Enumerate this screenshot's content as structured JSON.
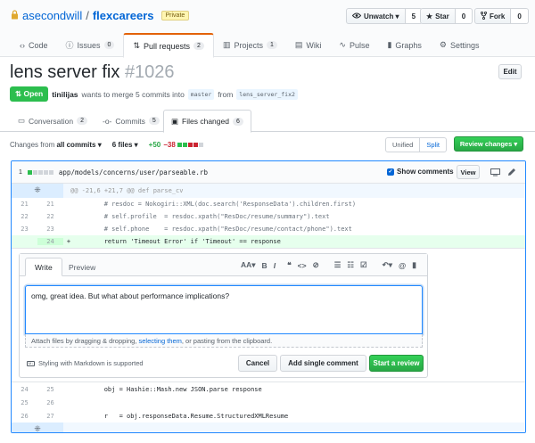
{
  "repo": {
    "owner": "asecondwill",
    "separator": "/",
    "name": "flexcareers",
    "visibility": "Private"
  },
  "actions": {
    "watch": {
      "label": "Unwatch ▾",
      "count": "5"
    },
    "star": {
      "label": "Star",
      "count": "0"
    },
    "fork": {
      "label": "Fork",
      "count": "0"
    }
  },
  "nav": [
    {
      "label": "Code",
      "icon": "code-icon"
    },
    {
      "label": "Issues",
      "count": "0",
      "icon": "issue-icon"
    },
    {
      "label": "Pull requests",
      "count": "2",
      "icon": "pull-request-icon",
      "selected": true
    },
    {
      "label": "Projects",
      "count": "1",
      "icon": "project-icon"
    },
    {
      "label": "Wiki",
      "icon": "book-icon"
    },
    {
      "label": "Pulse",
      "icon": "pulse-icon"
    },
    {
      "label": "Graphs",
      "icon": "graph-icon"
    },
    {
      "label": "Settings",
      "icon": "gear-icon"
    }
  ],
  "pr": {
    "title": "lens server fix",
    "number": "#1026",
    "edit_label": "Edit",
    "state": "Open",
    "author": "tinilijas",
    "summary": "wants to merge 5 commits into",
    "base_branch": "master",
    "from_word": "from",
    "head_branch": "lens_server_fix2"
  },
  "pr_tabs": {
    "conversation": {
      "label": "Conversation",
      "count": "2"
    },
    "commits": {
      "label": "Commits",
      "count": "5"
    },
    "files": {
      "label": "Files changed",
      "count": "6"
    }
  },
  "toolbar": {
    "changes_prefix": "Changes from",
    "changes_value": "all commits ▾",
    "files_label": "6 files ▾",
    "additions": "+50",
    "deletions": "−38",
    "unified": "Unified",
    "split": "Split",
    "review_changes": "Review changes ▾"
  },
  "file": {
    "changes": "1",
    "path": "app/models/concerns/user/parseable.rb",
    "show_comments": "Show comments",
    "view_label": "View"
  },
  "diff_top": {
    "hunk": "@@ -21,6 +21,7 @@ def parse_cv",
    "lines": [
      {
        "old": "21",
        "new": "21",
        "sign": "",
        "code": "        # resdoc = Nokogiri::XML(doc.search('ResponseData').children.first)"
      },
      {
        "old": "22",
        "new": "22",
        "sign": "",
        "code": "        # self.profile  = resdoc.xpath(\"ResDoc/resume/summary\").text"
      },
      {
        "old": "23",
        "new": "23",
        "sign": "",
        "code": "        # self.phone    = resdoc.xpath(\"ResDoc/resume/contact/phone\").text"
      },
      {
        "old": "",
        "new": "24",
        "sign": "+",
        "code": "        return 'Timeout Error' if 'Timeout' == response"
      }
    ]
  },
  "comment_form": {
    "tab_write": "Write",
    "tab_preview": "Preview",
    "toolbar_header": "AA▾",
    "toolbar_bold": "B",
    "toolbar_italic": "I",
    "toolbar_quote": "❝",
    "toolbar_code": "<>",
    "toolbar_link": "⊘",
    "toolbar_ul": "☰",
    "toolbar_ol": "☷",
    "toolbar_task": "☑",
    "toolbar_reply": "↶▾",
    "toolbar_mention": "@",
    "toolbar_bookmark": "▮",
    "text": "omg, great idea.  But what about performance implications?",
    "attach_prefix": "Attach files by dragging & dropping,",
    "attach_link": "selecting them",
    "attach_suffix": ", or pasting from the clipboard.",
    "markdown_note": "Styling with Markdown is supported",
    "cancel": "Cancel",
    "add_single": "Add single comment",
    "start_review": "Start a review"
  },
  "diff_bottom": [
    {
      "old": "24",
      "new": "25",
      "code": "        obj = Hashie::Mash.new JSON.parse response"
    },
    {
      "old": "25",
      "new": "26",
      "code": ""
    },
    {
      "old": "26",
      "new": "27",
      "code": "        r   = obj.responseData.Resume.StructuredXMLResume"
    }
  ],
  "colors": {
    "accent": "#0366d6",
    "green": "#28a745",
    "red": "#cb2431",
    "orange": "#e36209"
  }
}
